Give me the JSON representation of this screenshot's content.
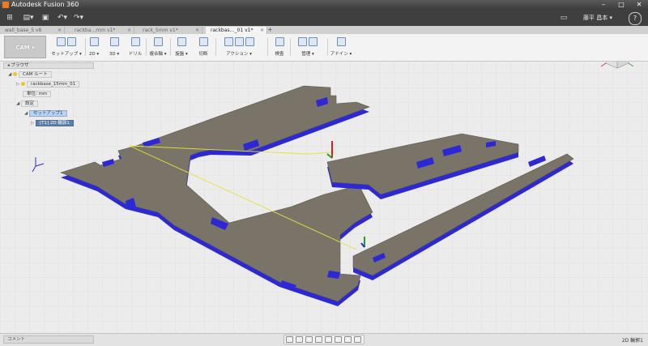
{
  "window": {
    "title": "Autodesk Fusion 360"
  },
  "qat": {
    "user": "藤平 昌本 ▾",
    "help": "?"
  },
  "tabs": [
    {
      "label": "wall_base_5 v8",
      "active": false
    },
    {
      "label": "rackba…mm v1*",
      "active": false
    },
    {
      "label": "rack_5mm v1*",
      "active": false
    },
    {
      "label": "rackbas…_01 v1*",
      "active": true
    }
  ],
  "toolbar": {
    "workspace": "CAM ▾",
    "groups": [
      {
        "label": "セットアップ ▾"
      },
      {
        "label": "2D ▾"
      },
      {
        "label": "3D ▾"
      },
      {
        "label": "ドリル"
      },
      {
        "label": "複合軸 ▾"
      },
      {
        "label": "旋盤 ▾"
      },
      {
        "label": "切断"
      },
      {
        "label": "アクション ▾"
      },
      {
        "label": "検査"
      },
      {
        "label": "管理 ▾"
      },
      {
        "label": "アドイン ▾"
      }
    ]
  },
  "browser": {
    "header": "ブラウザ",
    "nodes": {
      "cam_root": "CAM ルート",
      "model": "rackbase_15mm_01",
      "units": "単位: mm",
      "settings": "設定",
      "setup": "セットアップ1",
      "operation": "[T1] 2D 輪郭1"
    }
  },
  "statusbar": {
    "comment": "コメント",
    "status": "2D 輪郭1"
  },
  "colors": {
    "part": "#7a7468",
    "edge": "#2c28d6",
    "toolpath": "#e6e23a"
  }
}
